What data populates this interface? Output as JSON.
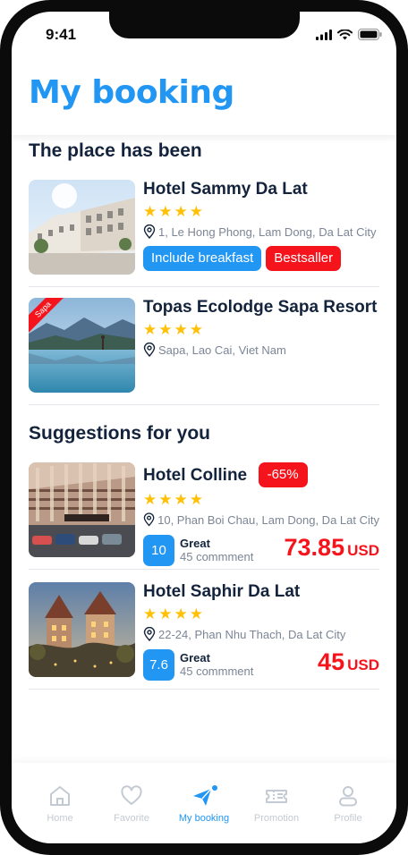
{
  "status_bar": {
    "time": "9:41"
  },
  "header": {
    "title": "My booking"
  },
  "visited": {
    "title": "The place has been",
    "items": [
      {
        "name": "Hotel Sammy Da Lat",
        "stars": "★★★★",
        "address": "1, Le Hong Phong, Lam Dong, Da Lat City",
        "tags": [
          "Include breakfast",
          "Bestsaller"
        ]
      },
      {
        "name": "Topas Ecolodge Sapa Resort",
        "stars": "★★★★",
        "address": "Sapa, Lao Cai, Viet Nam",
        "ribbon": "Sapa"
      }
    ]
  },
  "suggestions": {
    "title": "Suggestions for you",
    "items": [
      {
        "name": "Hotel Colline",
        "discount": "-65%",
        "stars": "★★★★",
        "address": "10, Phan Boi Chau, Lam Dong, Da Lat City",
        "score": "10",
        "rating_label": "Great",
        "rating_count": "45 commment",
        "price": "73.85",
        "currency": "USD"
      },
      {
        "name": "Hotel Saphir Da Lat",
        "stars": "★★★★",
        "address": "22-24, Phan Nhu Thach, Da Lat City",
        "score": "7.6",
        "rating_label": "Great",
        "rating_count": "45 commment",
        "price": "45",
        "currency": "USD"
      }
    ]
  },
  "tabbar": {
    "items": [
      {
        "label": "Home",
        "icon": "home-icon"
      },
      {
        "label": "Favorite",
        "icon": "heart-icon"
      },
      {
        "label": "My booking",
        "icon": "paper-plane-icon",
        "active": true
      },
      {
        "label": "Promotion",
        "icon": "ticket-icon"
      },
      {
        "label": "Profile",
        "icon": "person-icon"
      }
    ]
  },
  "colors": {
    "accent": "#2196f3",
    "alert": "#f5131c",
    "star": "#ffc107",
    "heading": "#14233c",
    "muted": "#7b8595"
  }
}
